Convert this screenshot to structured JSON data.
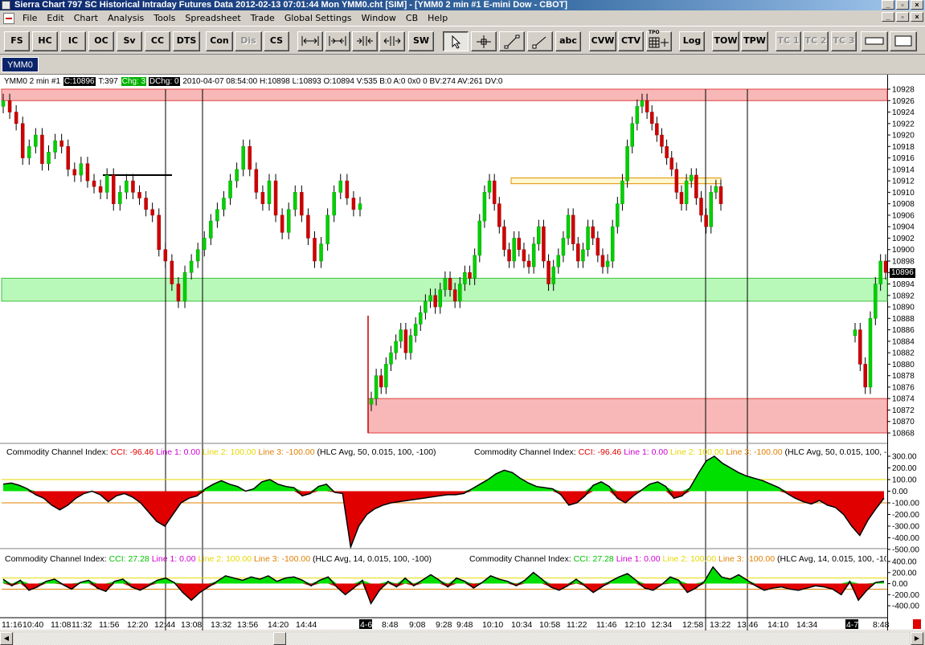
{
  "window": {
    "title": "Sierra Chart 797 SC Historical Intraday Futures Data 2012-02-13  07:01:44 Mon  YMM0.cht [SIM] - [YMM0  2 min   #1  E-mini Dow - CBOT]"
  },
  "menu": [
    "File",
    "Edit",
    "Chart",
    "Analysis",
    "Tools",
    "Spreadsheet",
    "Trade",
    "Global Settings",
    "Window",
    "CB",
    "Help"
  ],
  "toolbar": {
    "buttons": [
      "FS",
      "HC",
      "IC",
      "OC",
      "Sv",
      "CC",
      "DTS",
      "Con",
      "Dis",
      "CS"
    ],
    "draw_buttons": [
      "SW"
    ],
    "tool_text_button": "abc",
    "buttons2": [
      "CVW",
      "CTV"
    ],
    "tpo_label": "TPO",
    "buttons3": [
      "Log",
      "TOW",
      "TPW"
    ],
    "tc_buttons": [
      "TC 1",
      "TC 2",
      "TC 3"
    ]
  },
  "tab": {
    "label": "YMM0"
  },
  "chart_data": [
    {
      "type": "bar",
      "info": {
        "symbol": "YMM0  2 min   #1",
        "close_label": "C:10896",
        "trades": "T:397",
        "chg_label": "Chg: 3",
        "dchg_label": "DChg: 0",
        "rest": "2010-04-07 08:54:00 H:10898 L:10893 O:10894 V:535 B:0 A:0 0x0 0 BV:274 AV:261 DV:0"
      },
      "price_axis_labels": [
        "10928",
        "10926",
        "10924",
        "10922",
        "10920",
        "10918",
        "10916",
        "10914",
        "10912",
        "10910",
        "10908",
        "10906",
        "10904",
        "10902",
        "10900",
        "10898",
        "10896",
        "10894",
        "10892",
        "10890",
        "10888",
        "10886",
        "10884",
        "10882",
        "10880",
        "10878",
        "10876",
        "10874",
        "10872",
        "10870",
        "10868"
      ],
      "current_price": "10896",
      "ylim": [
        10868,
        10928
      ],
      "zones": [
        {
          "from": 10926,
          "to": 10928,
          "color": "#f8b8b8"
        },
        {
          "from": 10891,
          "to": 10895,
          "color": "#b8f8b8"
        },
        {
          "from": 10868,
          "to": 10874,
          "color": "#f8b8b8"
        },
        {
          "from": 10911.5,
          "to": 10912.5,
          "color": "#fff8d0"
        }
      ],
      "series": [
        {
          "values": [
            10926,
            10924,
            10922,
            10916,
            10918,
            10920,
            10915,
            10917,
            10919,
            10918,
            10914,
            10913,
            10915,
            10912,
            10911,
            10910,
            10913,
            10908,
            10910,
            10912,
            10910,
            10909,
            10907,
            10906,
            10900,
            10898,
            10894,
            10891,
            10896,
            10898,
            10900,
            10902,
            10905,
            10907,
            10909,
            10912,
            10914,
            10918,
            10914,
            10910,
            10908,
            10912,
            10906,
            10903,
            10907,
            10910,
            10906,
            10902,
            10898,
            10901,
            10906,
            10910,
            10912,
            10909,
            10907,
            10908
          ]
        },
        {
          "values": [
            10874,
            10878,
            10876,
            10880,
            10882,
            10884,
            10886,
            10882,
            10885,
            10887,
            10889,
            10891,
            10892,
            10890,
            10893,
            10895,
            10893,
            10891,
            10894,
            10896,
            10895,
            10899,
            10905,
            10910,
            10912,
            10908,
            10904,
            10900,
            10898,
            10902,
            10900,
            10898,
            10897,
            10901,
            10904,
            10898,
            10894,
            10897,
            10899,
            10902,
            10906,
            10901,
            10898,
            10900,
            10904,
            10902,
            10899,
            10897,
            10898,
            10904,
            10908,
            10912,
            10918,
            10922,
            10925,
            10926,
            10924,
            10922,
            10920,
            10918,
            10916,
            10914,
            10910,
            10908,
            10912,
            10913,
            10909,
            10906,
            10904,
            10910,
            10911,
            10908
          ]
        },
        {
          "values": [
            10886,
            10880,
            10876,
            10888,
            10894,
            10898,
            10896
          ]
        }
      ],
      "time_labels": [
        "11:16",
        "10:40",
        "11:08",
        "11:32",
        "11:56",
        "12:20",
        "12:44",
        "13:08",
        "13:32",
        "13:56",
        "14:20",
        "14:44",
        "4-6",
        "8:48",
        "9:08",
        "9:28",
        "9:48",
        "10:10",
        "10:34",
        "10:58",
        "11:22",
        "11:46",
        "12:10",
        "12:34",
        "12:58",
        "13:22",
        "13:46",
        "14:10",
        "14:34",
        "4-7",
        "8:48"
      ]
    },
    {
      "type": "area",
      "title": "Commodity Channel Index:",
      "cci_label": "CCI: -96.46",
      "line1": "Line 1: 0.00",
      "line2": "Line 2: 100.00",
      "line3": "Line 3: -100.00",
      "params": "(HLC Avg, 50, 0.015, 100, -100)",
      "ylim": [
        -500,
        300
      ],
      "axis_labels": [
        "300.00",
        "200.00",
        "100.00",
        "0.00",
        "-100.00",
        "-200.00",
        "-300.00",
        "-400.00",
        "-500.00"
      ],
      "lines": [
        100,
        0,
        -100
      ],
      "values": [
        60,
        70,
        50,
        20,
        -30,
        -60,
        -120,
        -160,
        -120,
        -60,
        -20,
        0,
        -30,
        -90,
        -40,
        -20,
        -50,
        -100,
        -180,
        -260,
        -300,
        -200,
        -100,
        -60,
        -40,
        20,
        60,
        90,
        60,
        40,
        0,
        20,
        80,
        100,
        60,
        40,
        30,
        -40,
        -20,
        40,
        60,
        -10,
        -20,
        -480,
        -300,
        -200,
        -150,
        -120,
        -100,
        -90,
        -80,
        -70,
        -60,
        -50,
        -40,
        -30,
        -30,
        -20,
        20,
        60,
        100,
        150,
        180,
        160,
        110,
        70,
        40,
        30,
        20,
        -30,
        -120,
        -100,
        -40,
        50,
        80,
        40,
        -60,
        -100,
        -40,
        10,
        60,
        80,
        40,
        -60,
        -40,
        30,
        150,
        260,
        300,
        240,
        200,
        160,
        130,
        110,
        90,
        60,
        30,
        -20,
        -60,
        -90,
        -110,
        -80,
        -120,
        -140,
        -200,
        -300,
        -380,
        -250,
        -150,
        -60
      ]
    },
    {
      "type": "area",
      "title": "Commodity Channel Index:",
      "cci_label": "CCI: 27.28",
      "line1": "Line 1: 0.00",
      "line2": "Line 2: 100.00",
      "line3": "Line 3: -100.00",
      "params": "(HLC Avg, 14, 0.015, 100, -100)",
      "ylim": [
        -500,
        400
      ],
      "axis_labels": [
        "400.00",
        "200.00",
        "0.00",
        "-200.00",
        "-400.00"
      ],
      "lines": [
        100,
        0,
        -100
      ],
      "values": [
        80,
        -40,
        60,
        -120,
        -60,
        40,
        80,
        -20,
        -100,
        20,
        60,
        -80,
        -140,
        40,
        80,
        -60,
        -120,
        -40,
        60,
        100,
        20,
        -160,
        -300,
        -160,
        -60,
        40,
        140,
        100,
        60,
        120,
        80,
        140,
        40,
        100,
        120,
        60,
        -40,
        60,
        120,
        -60,
        -200,
        -80,
        60,
        -360,
        -120,
        40,
        -60,
        100,
        -40,
        60,
        160,
        60,
        -60,
        100,
        40,
        -80,
        20,
        140,
        80,
        40,
        -40,
        60,
        200,
        80,
        -60,
        -120,
        -40,
        80,
        -40,
        -160,
        -60,
        40,
        120,
        180,
        60,
        -80,
        -120,
        -20,
        120,
        60,
        -160,
        -80,
        40,
        300,
        120,
        80,
        160,
        60,
        -40,
        -120,
        -80,
        -60,
        -100,
        -120,
        -80,
        -40,
        -60,
        -100,
        -200,
        40,
        -300,
        -120,
        20,
        40
      ]
    }
  ]
}
